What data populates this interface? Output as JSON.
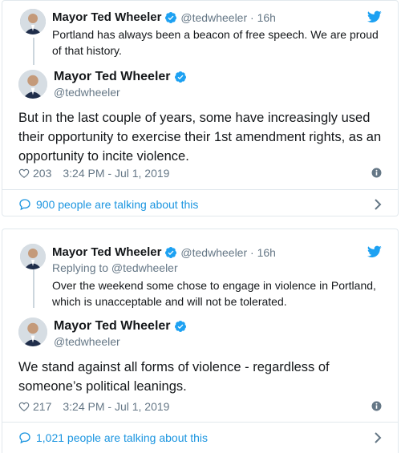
{
  "colors": {
    "accent": "#1b95e0",
    "verified": "#1da1f2",
    "secondary_text": "#657786",
    "border": "#e1e8ed"
  },
  "tweets": [
    {
      "parent": {
        "name": "Mayor Ted Wheeler",
        "handle_time": "@tedwheeler · 16h",
        "replying_to": "",
        "text": "Portland has always been a beacon of free speech. We are proud of that history."
      },
      "author": {
        "name": "Mayor Ted Wheeler",
        "handle": "@tedwheeler"
      },
      "text": "But in the last couple of years, some have increasingly used their opportunity to exercise their 1st amendment rights, as an opportunity to incite violence.",
      "likes": "203",
      "timestamp": "3:24 PM - Jul 1, 2019",
      "talking": "900 people are talking about this"
    },
    {
      "parent": {
        "name": "Mayor Ted Wheeler",
        "handle_time": "@tedwheeler · 16h",
        "replying_to": "Replying to @tedwheeler",
        "text": "Over the weekend some chose to engage in violence in Portland, which is unacceptable and will not be tolerated."
      },
      "author": {
        "name": "Mayor Ted Wheeler",
        "handle": "@tedwheeler"
      },
      "text": "We stand against all forms of violence - regardless of someone’s political leanings.",
      "likes": "217",
      "timestamp": "3:24 PM - Jul 1, 2019",
      "talking": "1,021 people are talking about this"
    }
  ]
}
